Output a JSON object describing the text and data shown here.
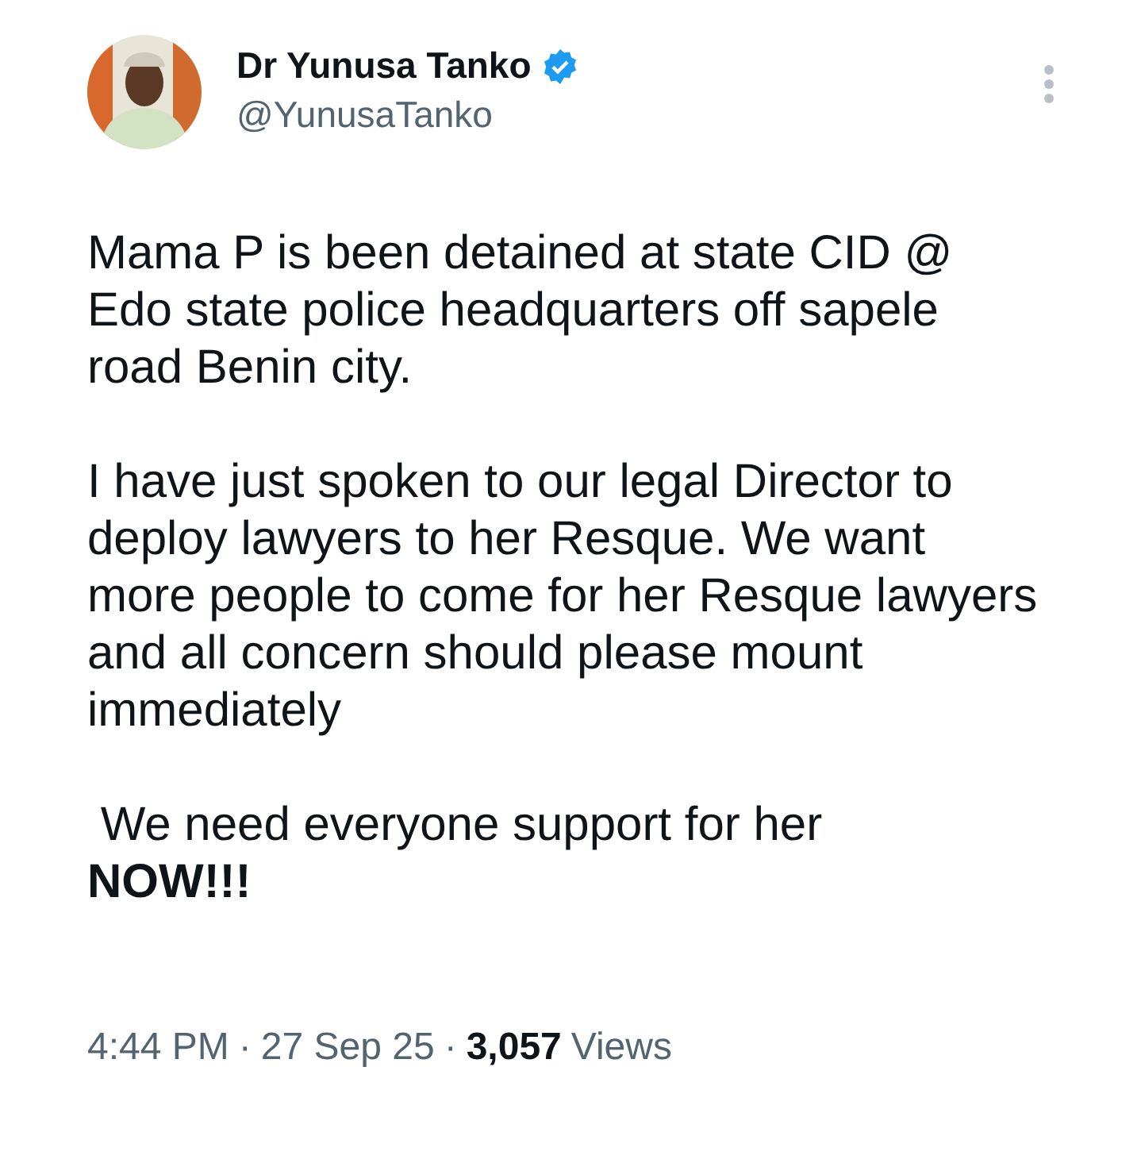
{
  "author": {
    "name": "Dr Yunusa Tanko",
    "verified": true,
    "handle": "@YunusaTanko"
  },
  "body": [
    "Mama P is been detained at state CID @ Edo state police headquarters off sapele road Benin city.",
    "I have just spoken to our legal Director to deploy lawyers to her Resque. We want more people to come for her Resque lawyers and all concern should please mount immediately",
    " We need everyone support for her\n**NOW!!!**"
  ],
  "meta": {
    "time": "4:44 PM",
    "separator_1": "·",
    "date": "27 Sep 25",
    "separator_2": "·",
    "views_count": "3,057",
    "views_label": "Views"
  }
}
